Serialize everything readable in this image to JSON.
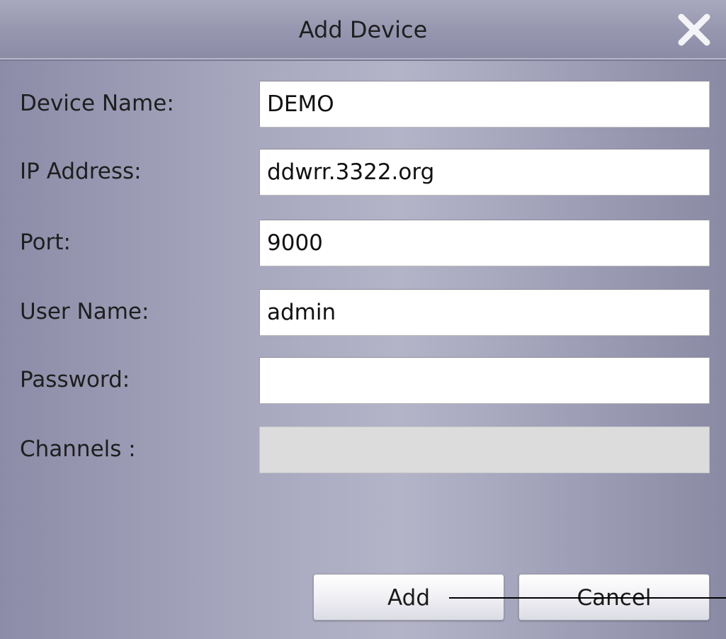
{
  "dialog": {
    "title": "Add Device",
    "close_icon": "close-icon"
  },
  "form": {
    "device_name": {
      "label": "Device Name:",
      "value": "DEMO",
      "placeholder": ""
    },
    "ip_address": {
      "label": "IP Address:",
      "value": "ddwrr.3322.org",
      "placeholder": ""
    },
    "port": {
      "label": "Port:",
      "value": "9000",
      "placeholder": ""
    },
    "user_name": {
      "label": "User Name:",
      "value": "admin",
      "placeholder": ""
    },
    "password": {
      "label": "Password:",
      "value": "",
      "placeholder": ""
    },
    "channels": {
      "label": "Channels :",
      "value": "",
      "disabled": true
    }
  },
  "buttons": {
    "add_label": "Add",
    "cancel_label": "Cancel"
  },
  "colors": {
    "background": "#a4a4bc",
    "titlebar": "#9898b1",
    "field_bg": "#ffffff",
    "disabled_field_bg": "#dcdcdc"
  }
}
